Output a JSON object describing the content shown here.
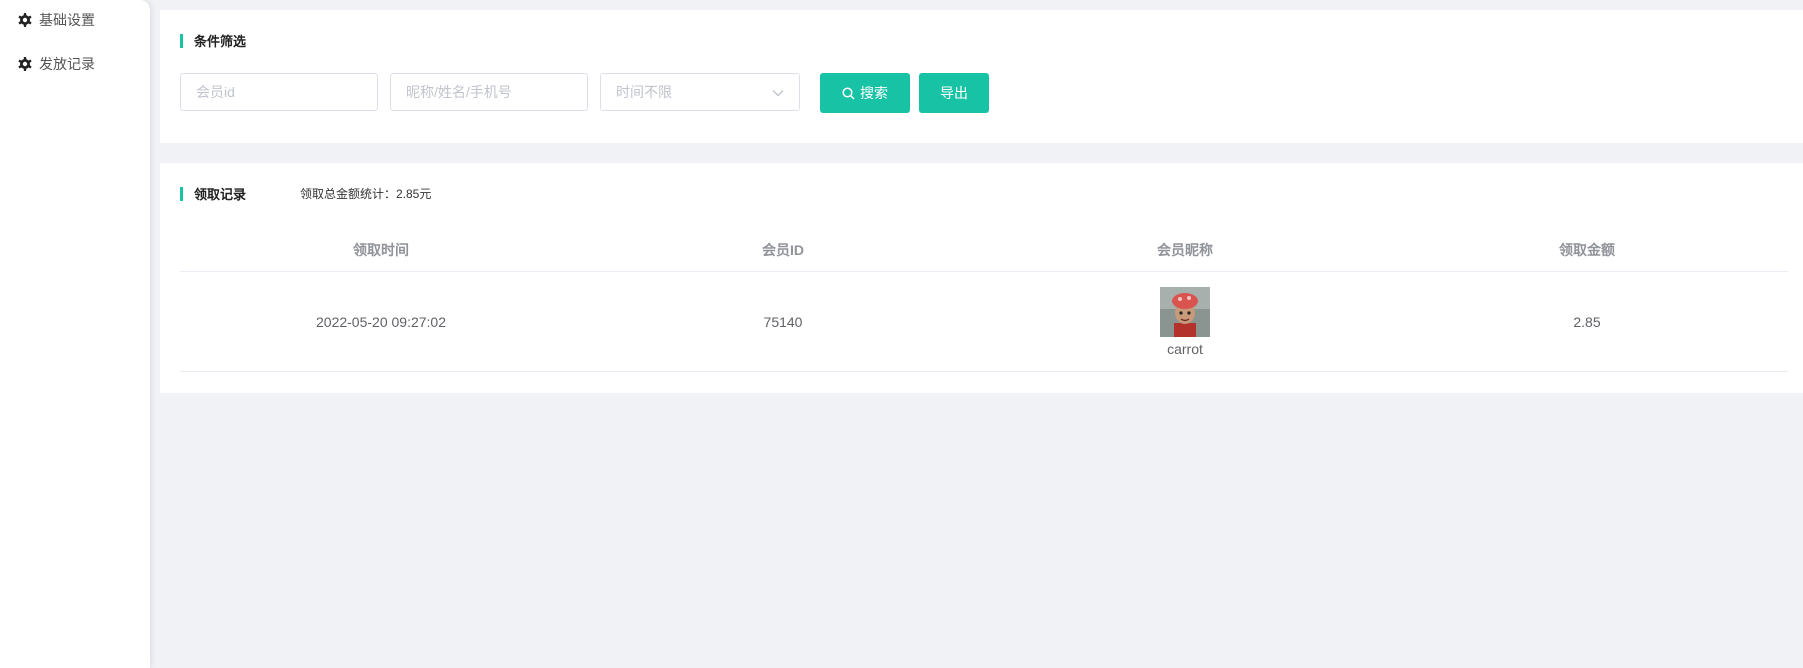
{
  "sidebar": {
    "items": [
      {
        "label": "基础设置",
        "icon": "gear-icon"
      },
      {
        "label": "发放记录",
        "icon": "gear-icon"
      }
    ]
  },
  "filter": {
    "title": "条件筛选",
    "member_id_placeholder": "会员id",
    "name_placeholder": "昵称/姓名/手机号",
    "time_select_value": "时间不限",
    "search_label": "搜索",
    "export_label": "导出"
  },
  "records": {
    "title": "领取记录",
    "total_stat": "领取总金额统计：2.85元",
    "columns": [
      "领取时间",
      "会员ID",
      "会员昵称",
      "领取金额"
    ],
    "rows": [
      {
        "time": "2022-05-20 09:27:02",
        "member_id": "75140",
        "nickname": "carrot",
        "amount": "2.85"
      }
    ]
  },
  "colors": {
    "accent": "#18c2a5",
    "background": "#f0f2f5"
  }
}
